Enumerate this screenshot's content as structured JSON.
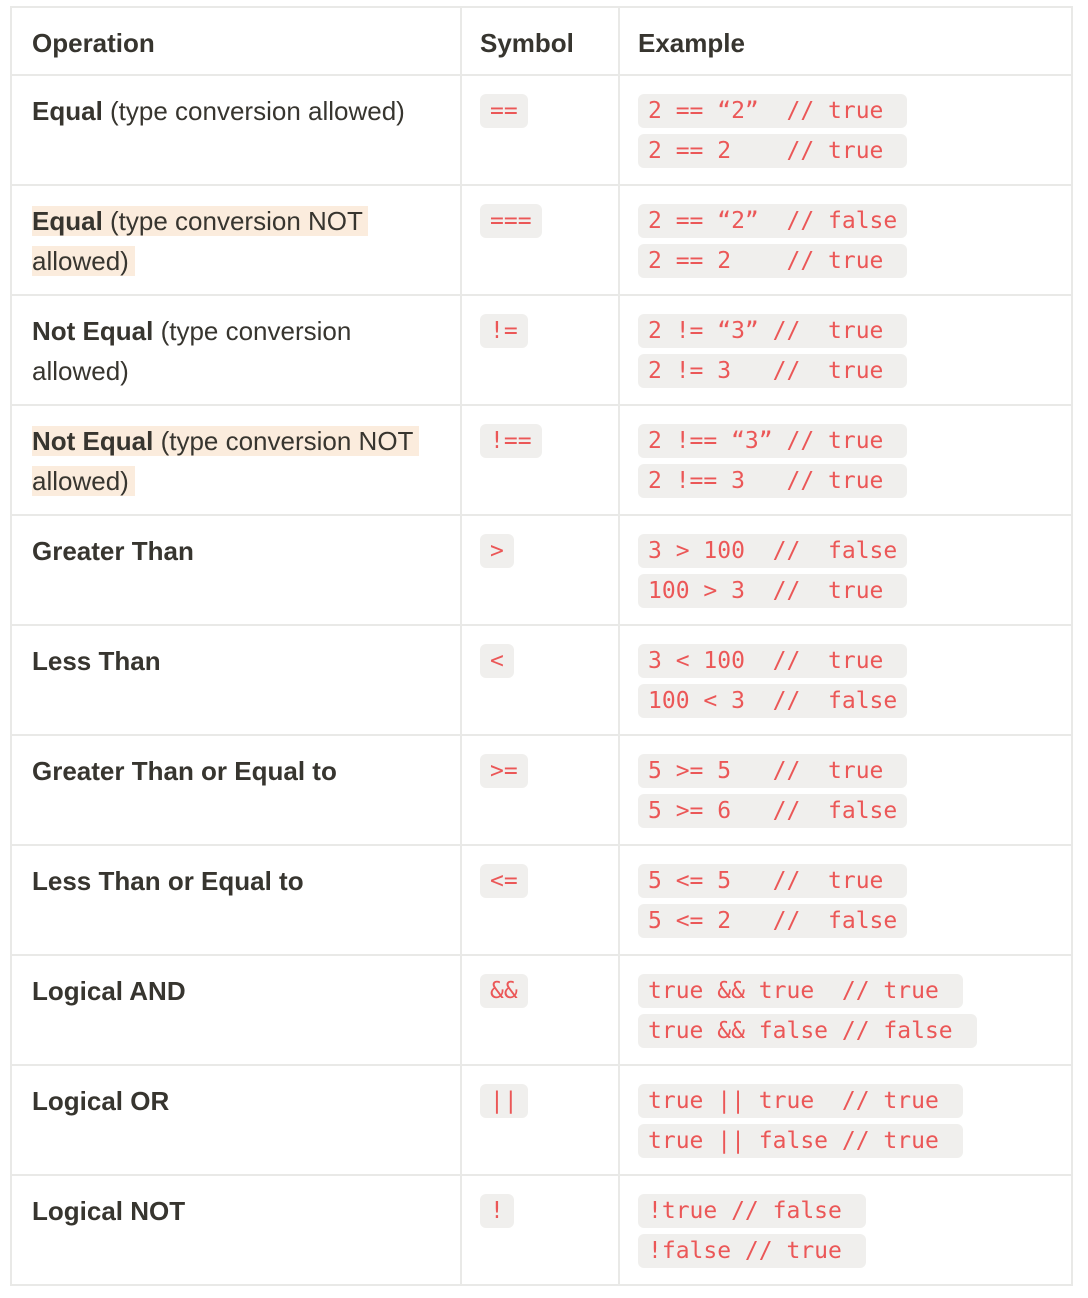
{
  "headers": {
    "operation": "Operation",
    "symbol": "Symbol",
    "example": "Example"
  },
  "rows": [
    {
      "name": "Equal",
      "desc": " (type conversion allowed)",
      "symbol": "==",
      "examples": [
        "2 == “2”  // true ",
        "2 == 2    // true "
      ]
    },
    {
      "name": "Equal",
      "desc": " (type conversion NOT allowed)",
      "symbol": "===",
      "examples": [
        "2 == “2”  // false",
        "2 == 2    // true "
      ]
    },
    {
      "name": "Not Equal",
      "desc": " (type conversion allowed)",
      "symbol": "!=",
      "examples": [
        "2 != “3” //  true ",
        "2 != 3   //  true "
      ]
    },
    {
      "name": "Not Equal",
      "desc": " (type conversion NOT allowed)",
      "symbol": "!==",
      "examples": [
        "2 !== “3” // true ",
        "2 !== 3   // true "
      ]
    },
    {
      "name": "Greater Than",
      "desc": "",
      "symbol": ">",
      "examples": [
        "3 > 100  //  false",
        "100 > 3  //  true "
      ]
    },
    {
      "name": "Less Than",
      "desc": "",
      "symbol": "<",
      "examples": [
        "3 < 100  //  true ",
        "100 < 3  //  false"
      ]
    },
    {
      "name": "Greater Than or Equal to",
      "desc": "",
      "symbol": ">=",
      "examples": [
        "5 >= 5   //  true ",
        "5 >= 6   //  false"
      ]
    },
    {
      "name": "Less Than or Equal to",
      "desc": "",
      "symbol": "<=",
      "examples": [
        "5 <= 5   //  true ",
        "5 <= 2   //  false"
      ]
    },
    {
      "name": "Logical AND",
      "desc": "",
      "symbol": "&&",
      "examples": [
        "true && true  // true ",
        "true && false // false "
      ]
    },
    {
      "name": "Logical OR",
      "desc": "",
      "symbol": "||",
      "examples": [
        "true || true  // true ",
        "true || false // true "
      ]
    },
    {
      "name": "Logical NOT",
      "desc": "",
      "symbol": "!",
      "examples": [
        "!true // false ",
        "!false // true "
      ]
    }
  ],
  "highlight_color": "#fbecdd",
  "code_color": "#eb5757",
  "code_background": "#f0efed"
}
